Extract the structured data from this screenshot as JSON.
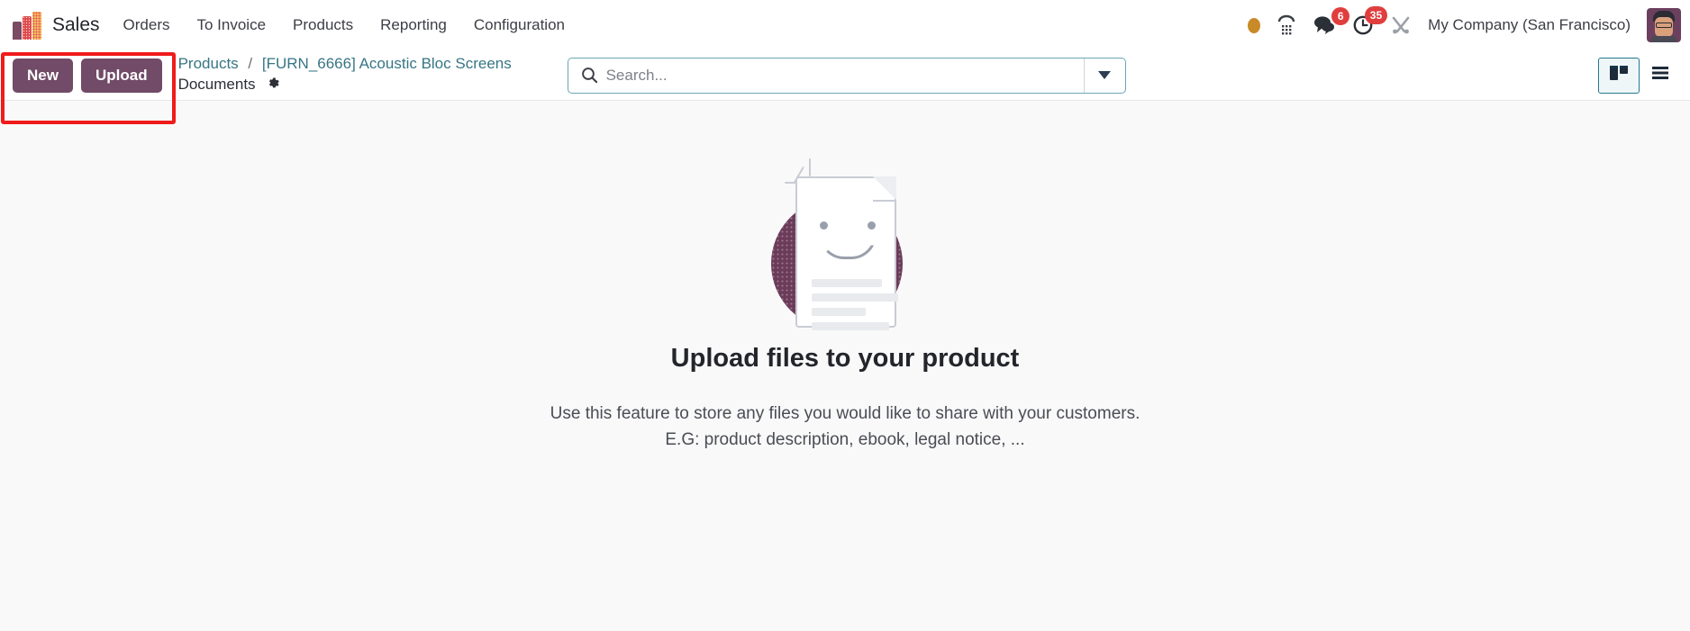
{
  "navbar": {
    "app_name": "Sales",
    "logo_icon": "sales-bar-chart-icon",
    "menu_items": [
      {
        "label": "Orders"
      },
      {
        "label": "To Invoice"
      },
      {
        "label": "Products"
      },
      {
        "label": "Reporting"
      },
      {
        "label": "Configuration"
      }
    ],
    "status_dot_icon": "presence-dot-icon",
    "voip_icon": "phone-dialpad-icon",
    "messages_icon": "chat-bubbles-icon",
    "messages_count": "6",
    "activities_icon": "clock-activity-icon",
    "activities_count": "35",
    "debug_icon": "tools-wrench-icon",
    "company": "My Company (San Francisco)",
    "avatar_icon": "user-avatar-icon"
  },
  "control_panel": {
    "new_label": "New",
    "upload_label": "Upload",
    "breadcrumb": {
      "root": "Products",
      "separator": "/",
      "record": "[FURN_6666] Acoustic Bloc Screens",
      "current": "Documents",
      "gear_icon": "gear-icon"
    },
    "search": {
      "placeholder": "Search...",
      "value": "",
      "icon": "search-icon",
      "toggle_icon": "chevron-down-icon"
    },
    "views": [
      {
        "name": "kanban",
        "icon": "kanban-view-icon",
        "active": true
      },
      {
        "name": "list",
        "icon": "list-view-icon",
        "active": false
      }
    ]
  },
  "empty_state": {
    "illustration_icon": "smiling-document-icon",
    "title": "Upload files to your product",
    "subtitle_line1": "Use this feature to store any files you would like to share with your customers.",
    "subtitle_line2": "E.G: product description, ebook, legal notice, ..."
  },
  "colors": {
    "brand_purple": "#714b67",
    "link_teal": "#377684",
    "badge_red": "#e03e3e",
    "highlight_red": "#f01b1b",
    "content_bg": "#f9f9f9"
  }
}
